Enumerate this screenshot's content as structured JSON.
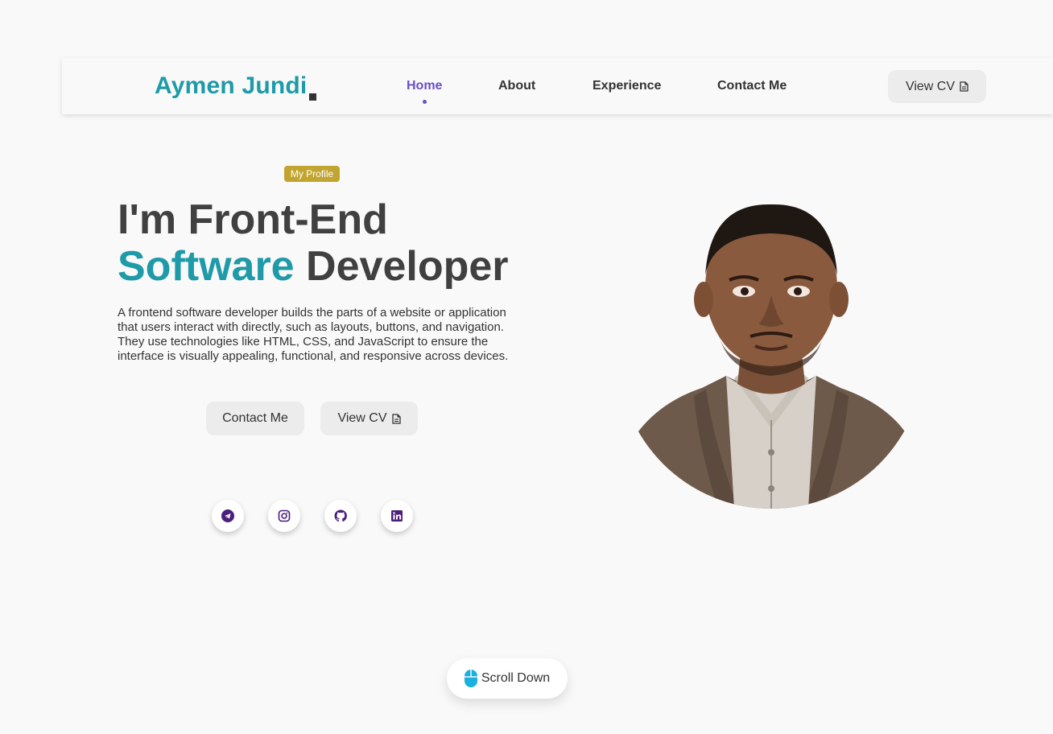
{
  "nav": {
    "logo": "Aymen Jundi",
    "links": [
      "Home",
      "About",
      "Experience",
      "Contact Me"
    ],
    "active_link": "Home",
    "cv_button": "View CV",
    "accent": "#6b4fc8"
  },
  "hero": {
    "badge": "My Profile",
    "title_line1": "I'm Front-End",
    "title_accent": "Software",
    "title_rest": " Developer",
    "description": "A frontend software developer builds the parts of a website or application that users interact with directly, such as layouts, buttons, and navigation. They use technologies like HTML, CSS, and JavaScript to ensure the interface is visually appealing, functional, and responsive across devices.",
    "contact_button": "Contact Me",
    "cv_button": "View CV",
    "accent_color": "#1e9aa8"
  },
  "social": [
    "telegram-icon",
    "instagram-icon",
    "github-icon",
    "linkedin-icon"
  ],
  "scroll": {
    "label": "Scroll Down"
  }
}
